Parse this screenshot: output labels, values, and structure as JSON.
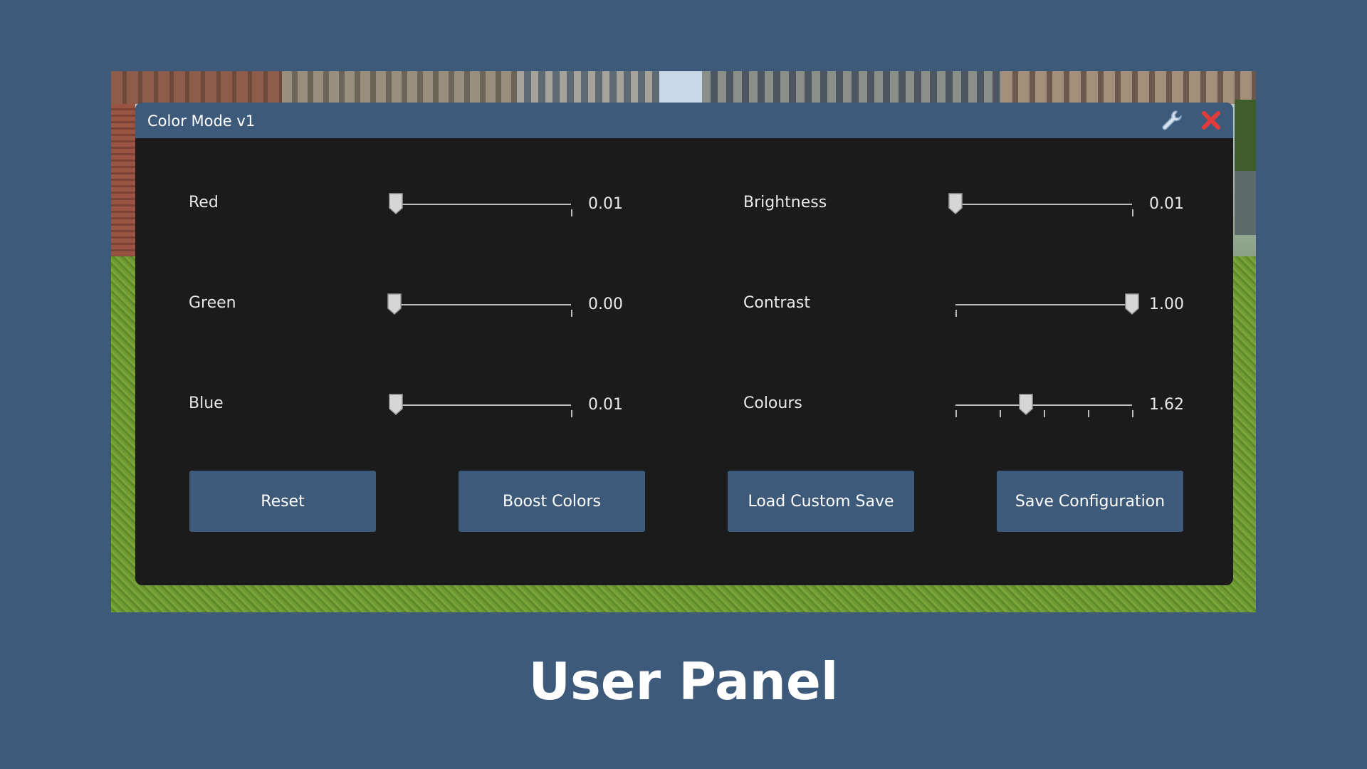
{
  "window": {
    "title": "Color Mode v1"
  },
  "icons": {
    "settings": "wrench-icon",
    "close": "close-icon"
  },
  "colors": {
    "accent": "#3d5a7a",
    "panel": "#1b1b1b",
    "close": "#e23b3b"
  },
  "sliders": {
    "red": {
      "label": "Red",
      "value": "0.01",
      "level": 0.01
    },
    "green": {
      "label": "Green",
      "value": "0.00",
      "level": 0.0
    },
    "blue": {
      "label": "Blue",
      "value": "0.01",
      "level": 0.01
    },
    "brightness": {
      "label": "Brightness",
      "value": "0.01",
      "level": 0.0
    },
    "contrast": {
      "label": "Contrast",
      "value": "1.00",
      "level": 1.0
    },
    "colours": {
      "label": "Colours",
      "value": "1.62",
      "level": 0.4
    }
  },
  "buttons": {
    "reset": "Reset",
    "boost": "Boost Colors",
    "load": "Load Custom Save",
    "save": "Save Configuration"
  },
  "caption": "User Panel"
}
